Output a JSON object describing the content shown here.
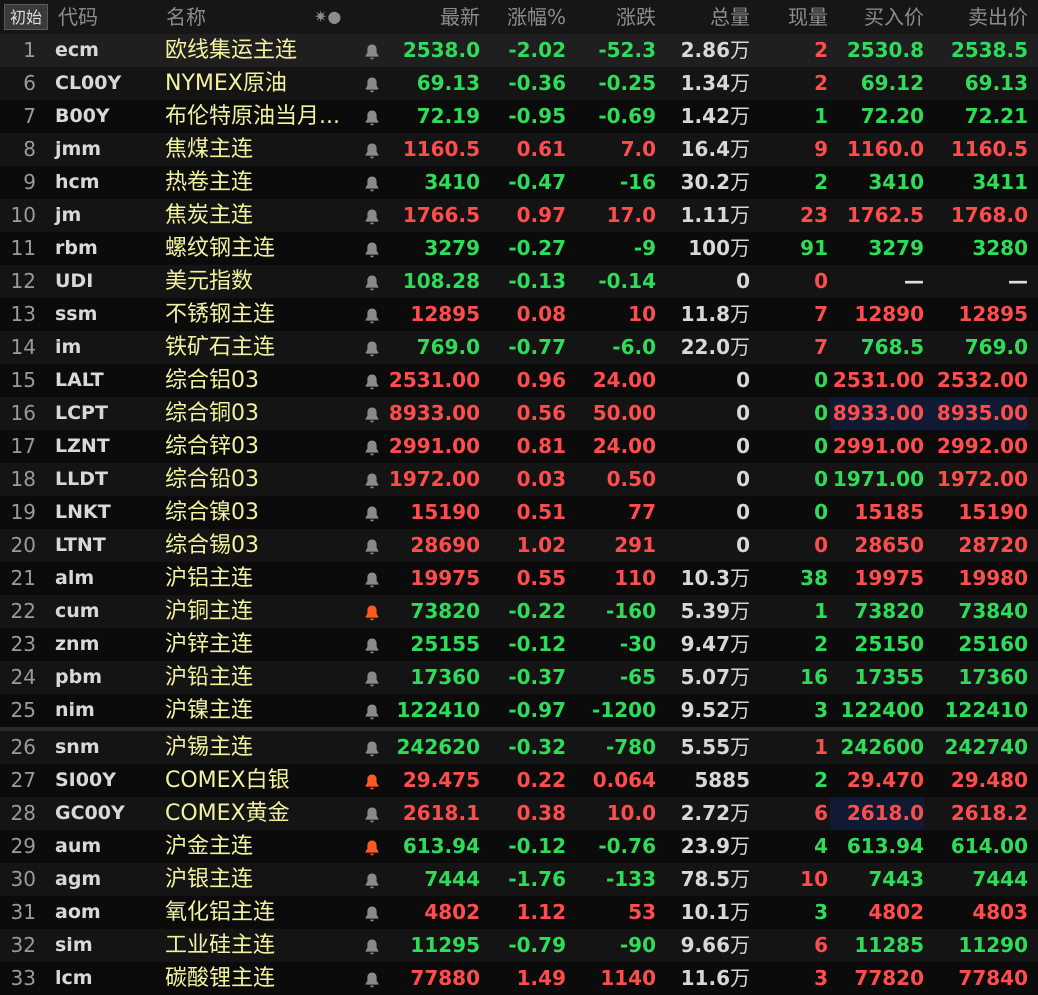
{
  "header": {
    "tag": "初始",
    "cols": [
      "代码",
      "名称",
      "✷●",
      "最新",
      "涨幅%",
      "涨跌",
      "总量",
      "现量",
      "买入价",
      "卖出价"
    ]
  },
  "colors": {
    "up": "#ff4d4d",
    "down": "#2fdc5a",
    "name": "#f2f2a0",
    "alert": "#ff5a1f"
  },
  "rows": [
    {
      "n": "1",
      "code": "ecm",
      "name": "欧线集运主连",
      "bell": "gray",
      "last": "2538.0",
      "pct": "-2.02",
      "chg": "-52.3",
      "vol": "2.86",
      "unit": "万",
      "cur": "2",
      "bid": "2530.8",
      "ask": "2538.5",
      "dir": "dn",
      "curDir": "up",
      "bidDir": "dn",
      "askDir": "dn"
    },
    {
      "n": "6",
      "code": "CL00Y",
      "name": "NYMEX原油",
      "bell": "gray",
      "last": "69.13",
      "pct": "-0.36",
      "chg": "-0.25",
      "vol": "1.34",
      "unit": "万",
      "cur": "2",
      "bid": "69.12",
      "ask": "69.13",
      "dir": "dn",
      "curDir": "up",
      "bidDir": "dn",
      "askDir": "dn"
    },
    {
      "n": "7",
      "code": "B00Y",
      "name": "布伦特原油当月...",
      "bell": "gray",
      "last": "72.19",
      "pct": "-0.95",
      "chg": "-0.69",
      "vol": "1.42",
      "unit": "万",
      "cur": "1",
      "bid": "72.20",
      "ask": "72.21",
      "dir": "dn",
      "curDir": "dn",
      "bidDir": "dn",
      "askDir": "dn"
    },
    {
      "n": "8",
      "code": "jmm",
      "name": "焦煤主连",
      "bell": "gray",
      "last": "1160.5",
      "pct": "0.61",
      "chg": "7.0",
      "vol": "16.4",
      "unit": "万",
      "cur": "9",
      "bid": "1160.0",
      "ask": "1160.5",
      "dir": "up",
      "curDir": "up",
      "bidDir": "up",
      "askDir": "up"
    },
    {
      "n": "9",
      "code": "hcm",
      "name": "热卷主连",
      "bell": "gray",
      "last": "3410",
      "pct": "-0.47",
      "chg": "-16",
      "vol": "30.2",
      "unit": "万",
      "cur": "2",
      "bid": "3410",
      "ask": "3411",
      "dir": "dn",
      "curDir": "dn",
      "bidDir": "dn",
      "askDir": "dn"
    },
    {
      "n": "10",
      "code": "jm",
      "name": "焦炭主连",
      "bell": "gray",
      "last": "1766.5",
      "pct": "0.97",
      "chg": "17.0",
      "vol": "1.11",
      "unit": "万",
      "cur": "23",
      "bid": "1762.5",
      "ask": "1768.0",
      "dir": "up",
      "curDir": "up",
      "bidDir": "up",
      "askDir": "up"
    },
    {
      "n": "11",
      "code": "rbm",
      "name": "螺纹钢主连",
      "bell": "gray",
      "last": "3279",
      "pct": "-0.27",
      "chg": "-9",
      "vol": "100",
      "unit": "万",
      "cur": "91",
      "bid": "3279",
      "ask": "3280",
      "dir": "dn",
      "curDir": "dn",
      "bidDir": "dn",
      "askDir": "dn"
    },
    {
      "n": "12",
      "code": "UDI",
      "name": "美元指数",
      "bell": "gray",
      "last": "108.28",
      "pct": "-0.13",
      "chg": "-0.14",
      "vol": "0",
      "unit": "",
      "cur": "0",
      "bid": "—",
      "ask": "—",
      "dir": "dn",
      "curDir": "up",
      "bidDir": "wh",
      "askDir": "wh"
    },
    {
      "n": "13",
      "code": "ssm",
      "name": "不锈钢主连",
      "bell": "gray",
      "last": "12895",
      "pct": "0.08",
      "chg": "10",
      "vol": "11.8",
      "unit": "万",
      "cur": "7",
      "bid": "12890",
      "ask": "12895",
      "dir": "up",
      "curDir": "up",
      "bidDir": "up",
      "askDir": "up"
    },
    {
      "n": "14",
      "code": "im",
      "name": "铁矿石主连",
      "bell": "gray",
      "last": "769.0",
      "pct": "-0.77",
      "chg": "-6.0",
      "vol": "22.0",
      "unit": "万",
      "cur": "7",
      "bid": "768.5",
      "ask": "769.0",
      "dir": "dn",
      "curDir": "up",
      "bidDir": "dn",
      "askDir": "dn"
    },
    {
      "n": "15",
      "code": "LALT",
      "name": "综合铝03",
      "bell": "gray",
      "last": "2531.00",
      "pct": "0.96",
      "chg": "24.00",
      "vol": "0",
      "unit": "",
      "cur": "0",
      "bid": "2531.00",
      "ask": "2532.00",
      "dir": "up",
      "curDir": "dn",
      "bidDir": "up",
      "askDir": "up"
    },
    {
      "n": "16",
      "code": "LCPT",
      "name": "综合铜03",
      "bell": "gray",
      "last": "8933.00",
      "pct": "0.56",
      "chg": "50.00",
      "vol": "0",
      "unit": "",
      "cur": "0",
      "bid": "8933.00",
      "ask": "8935.00",
      "dir": "up",
      "curDir": "dn",
      "bidDir": "up",
      "askDir": "up",
      "hlBid": true,
      "hlAsk": true
    },
    {
      "n": "17",
      "code": "LZNT",
      "name": "综合锌03",
      "bell": "gray",
      "last": "2991.00",
      "pct": "0.81",
      "chg": "24.00",
      "vol": "0",
      "unit": "",
      "cur": "0",
      "bid": "2991.00",
      "ask": "2992.00",
      "dir": "up",
      "curDir": "dn",
      "bidDir": "up",
      "askDir": "up"
    },
    {
      "n": "18",
      "code": "LLDT",
      "name": "综合铅03",
      "bell": "gray",
      "last": "1972.00",
      "pct": "0.03",
      "chg": "0.50",
      "vol": "0",
      "unit": "",
      "cur": "0",
      "bid": "1971.00",
      "ask": "1972.00",
      "dir": "up",
      "curDir": "dn",
      "bidDir": "dn",
      "askDir": "up"
    },
    {
      "n": "19",
      "code": "LNKT",
      "name": "综合镍03",
      "bell": "gray",
      "last": "15190",
      "pct": "0.51",
      "chg": "77",
      "vol": "0",
      "unit": "",
      "cur": "0",
      "bid": "15185",
      "ask": "15190",
      "dir": "up",
      "curDir": "dn",
      "bidDir": "up",
      "askDir": "up"
    },
    {
      "n": "20",
      "code": "LTNT",
      "name": "综合锡03",
      "bell": "gray",
      "last": "28690",
      "pct": "1.02",
      "chg": "291",
      "vol": "0",
      "unit": "",
      "cur": "0",
      "bid": "28650",
      "ask": "28720",
      "dir": "up",
      "curDir": "up",
      "bidDir": "up",
      "askDir": "up"
    },
    {
      "n": "21",
      "code": "alm",
      "name": "沪铝主连",
      "bell": "gray",
      "last": "19975",
      "pct": "0.55",
      "chg": "110",
      "vol": "10.3",
      "unit": "万",
      "cur": "38",
      "bid": "19975",
      "ask": "19980",
      "dir": "up",
      "curDir": "dn",
      "bidDir": "up",
      "askDir": "up"
    },
    {
      "n": "22",
      "code": "cum",
      "name": "沪铜主连",
      "bell": "orange",
      "last": "73820",
      "pct": "-0.22",
      "chg": "-160",
      "vol": "5.39",
      "unit": "万",
      "cur": "1",
      "bid": "73820",
      "ask": "73840",
      "dir": "dn",
      "curDir": "dn",
      "bidDir": "dn",
      "askDir": "dn"
    },
    {
      "n": "23",
      "code": "znm",
      "name": "沪锌主连",
      "bell": "gray",
      "last": "25155",
      "pct": "-0.12",
      "chg": "-30",
      "vol": "9.47",
      "unit": "万",
      "cur": "2",
      "bid": "25150",
      "ask": "25160",
      "dir": "dn",
      "curDir": "dn",
      "bidDir": "dn",
      "askDir": "dn"
    },
    {
      "n": "24",
      "code": "pbm",
      "name": "沪铅主连",
      "bell": "gray",
      "last": "17360",
      "pct": "-0.37",
      "chg": "-65",
      "vol": "5.07",
      "unit": "万",
      "cur": "16",
      "bid": "17355",
      "ask": "17360",
      "dir": "dn",
      "curDir": "dn",
      "bidDir": "dn",
      "askDir": "dn"
    },
    {
      "n": "25",
      "code": "nim",
      "name": "沪镍主连",
      "bell": "gray",
      "last": "122410",
      "pct": "-0.97",
      "chg": "-1200",
      "vol": "9.52",
      "unit": "万",
      "cur": "3",
      "bid": "122400",
      "ask": "122410",
      "dir": "dn",
      "curDir": "dn",
      "bidDir": "dn",
      "askDir": "dn"
    },
    {
      "n": "26",
      "code": "snm",
      "name": "沪锡主连",
      "bell": "gray",
      "last": "242620",
      "pct": "-0.32",
      "chg": "-780",
      "vol": "5.55",
      "unit": "万",
      "cur": "1",
      "bid": "242600",
      "ask": "242740",
      "dir": "dn",
      "curDir": "up",
      "bidDir": "dn",
      "askDir": "dn"
    },
    {
      "n": "27",
      "code": "SI00Y",
      "name": "COMEX白银",
      "bell": "orange",
      "last": "29.475",
      "pct": "0.22",
      "chg": "0.064",
      "vol": "5885",
      "unit": "",
      "cur": "2",
      "bid": "29.470",
      "ask": "29.480",
      "dir": "up",
      "curDir": "dn",
      "bidDir": "up",
      "askDir": "up"
    },
    {
      "n": "28",
      "code": "GC00Y",
      "name": "COMEX黄金",
      "bell": "gray",
      "last": "2618.1",
      "pct": "0.38",
      "chg": "10.0",
      "vol": "2.72",
      "unit": "万",
      "cur": "6",
      "bid": "2618.0",
      "ask": "2618.2",
      "dir": "up",
      "curDir": "up",
      "bidDir": "up",
      "askDir": "up",
      "hlBid": true
    },
    {
      "n": "29",
      "code": "aum",
      "name": "沪金主连",
      "bell": "orange",
      "last": "613.94",
      "pct": "-0.12",
      "chg": "-0.76",
      "vol": "23.9",
      "unit": "万",
      "cur": "4",
      "bid": "613.94",
      "ask": "614.00",
      "dir": "dn",
      "curDir": "dn",
      "bidDir": "dn",
      "askDir": "dn"
    },
    {
      "n": "30",
      "code": "agm",
      "name": "沪银主连",
      "bell": "gray",
      "last": "7444",
      "pct": "-1.76",
      "chg": "-133",
      "vol": "78.5",
      "unit": "万",
      "cur": "10",
      "bid": "7443",
      "ask": "7444",
      "dir": "dn",
      "curDir": "up",
      "bidDir": "dn",
      "askDir": "dn"
    },
    {
      "n": "31",
      "code": "aom",
      "name": "氧化铝主连",
      "bell": "gray",
      "last": "4802",
      "pct": "1.12",
      "chg": "53",
      "vol": "10.1",
      "unit": "万",
      "cur": "3",
      "bid": "4802",
      "ask": "4803",
      "dir": "up",
      "curDir": "dn",
      "bidDir": "up",
      "askDir": "up"
    },
    {
      "n": "32",
      "code": "sim",
      "name": "工业硅主连",
      "bell": "gray",
      "last": "11295",
      "pct": "-0.79",
      "chg": "-90",
      "vol": "9.66",
      "unit": "万",
      "cur": "6",
      "bid": "11285",
      "ask": "11290",
      "dir": "dn",
      "curDir": "up",
      "bidDir": "dn",
      "askDir": "dn"
    },
    {
      "n": "33",
      "code": "lcm",
      "name": "碳酸锂主连",
      "bell": "gray",
      "last": "77880",
      "pct": "1.49",
      "chg": "1140",
      "vol": "11.6",
      "unit": "万",
      "cur": "3",
      "bid": "77820",
      "ask": "77840",
      "dir": "up",
      "curDir": "up",
      "bidDir": "up",
      "askDir": "up"
    }
  ]
}
